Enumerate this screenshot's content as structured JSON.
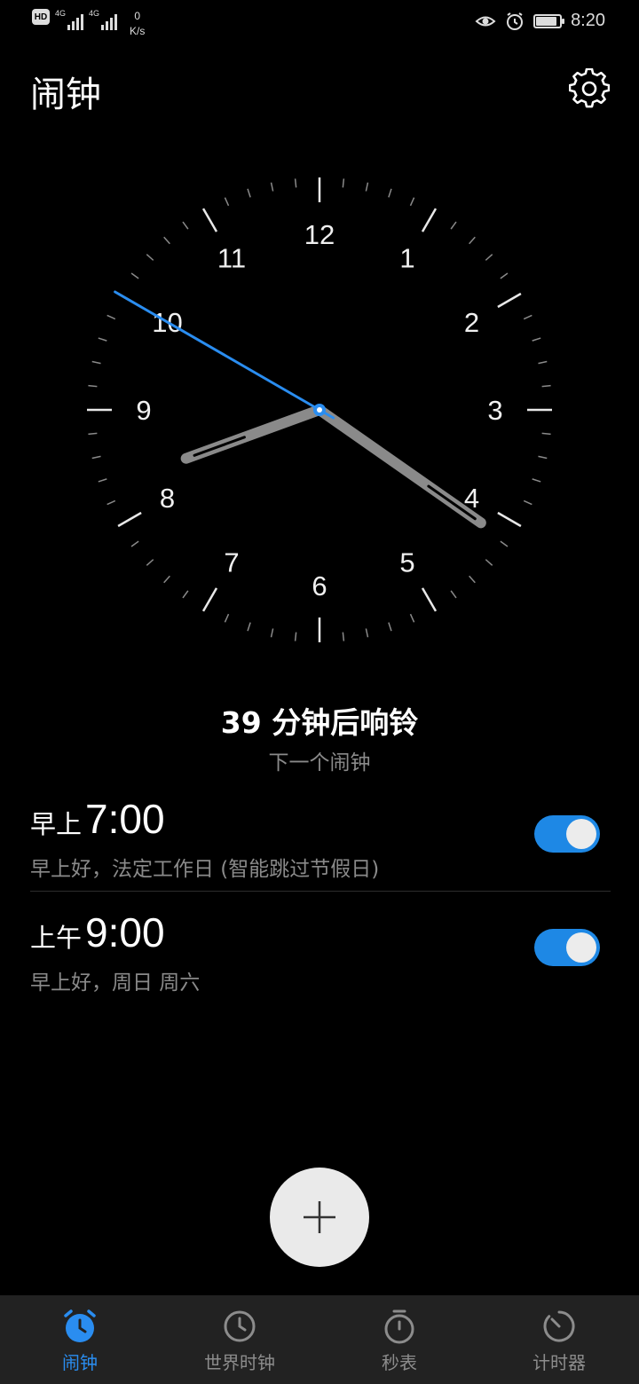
{
  "status_bar": {
    "hd": "HD",
    "sim1_tag": "4G",
    "sim2_tag": "4G",
    "speed_value": "0",
    "speed_unit": "K/s",
    "time": "8:20",
    "battery_level": 0.9,
    "icons": [
      "eye-icon",
      "alarm-icon",
      "battery-icon"
    ]
  },
  "header": {
    "title": "闹钟",
    "settings_icon": "gear-icon"
  },
  "clock": {
    "numbers": [
      "12",
      "1",
      "2",
      "3",
      "4",
      "5",
      "6",
      "7",
      "8",
      "9",
      "10",
      "11"
    ],
    "time": {
      "hour": 8,
      "minute": 20,
      "second": 50
    },
    "accent_color": "#2a8df0"
  },
  "countdown": {
    "text": "39 分钟后响铃",
    "subtitle": "下一个闹钟"
  },
  "alarms": [
    {
      "period": "早上",
      "time": "7:00",
      "description": "早上好，法定工作日 (智能跳过节假日)",
      "enabled": true
    },
    {
      "period": "上午",
      "time": "9:00",
      "description": "早上好，周日 周六",
      "enabled": true
    }
  ],
  "fab": {
    "icon": "plus-icon"
  },
  "tabs": [
    {
      "label": "闹钟",
      "icon": "alarm-clock-icon",
      "active": true
    },
    {
      "label": "世界时钟",
      "icon": "clock-icon",
      "active": false
    },
    {
      "label": "秒表",
      "icon": "stopwatch-icon",
      "active": false
    },
    {
      "label": "计时器",
      "icon": "timer-icon",
      "active": false
    }
  ]
}
